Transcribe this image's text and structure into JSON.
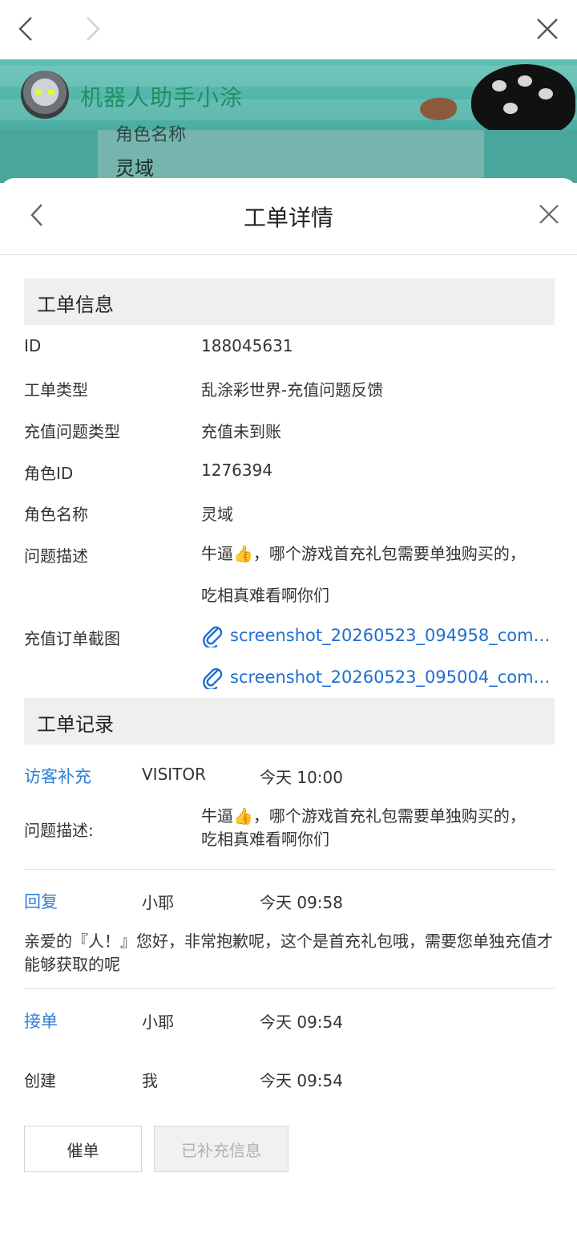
{
  "browser": {
    "back_icon": "chevron-left-icon",
    "forward_icon": "chevron-right-icon",
    "close_icon": "close-icon"
  },
  "banner": {
    "title": "机器人助手小涂",
    "bg_color": "#4aada3",
    "title_color": "#1f8f64"
  },
  "background_page": {
    "label": "角色名称",
    "value": "灵域"
  },
  "sheet": {
    "title": "工单详情"
  },
  "ticket_info": {
    "heading": "工单信息",
    "rows": [
      {
        "label": "ID",
        "value": "188045631"
      },
      {
        "label": "工单类型",
        "value": "乱涂彩世界-充值问题反馈"
      },
      {
        "label": "充值问题类型",
        "value": "充值未到账"
      },
      {
        "label": "角色ID",
        "value": "1276394"
      },
      {
        "label": "角色名称",
        "value": "灵域"
      },
      {
        "label": "问题描述",
        "value": "牛逼👍，哪个游戏首充礼包需要单独购买的，吃相真难看啊你们"
      }
    ],
    "screenshot_label": "充值订单截图",
    "attachments": [
      "screenshot_20260523_094958_com.b...",
      "screenshot_20260523_095004_com.b..."
    ]
  },
  "ticket_records": {
    "heading": "工单记录",
    "visitor_supplement": {
      "action": "访客补充",
      "who": "VISITOR",
      "time": "今天 10:00",
      "desc_label": "问题描述:",
      "desc_value": "牛逼👍，哪个游戏首充礼包需要单独购买的，吃相真难看啊你们"
    },
    "reply": {
      "action": "回复",
      "who": "小耶",
      "time": "今天 09:58",
      "message": "亲爱的『人！』您好，非常抱歉呢，这个是首充礼包哦，需要您单独充值才能够获取的呢"
    },
    "accept": {
      "action": "接单",
      "who": "小耶",
      "time": "今天 09:54"
    },
    "create": {
      "action": "创建",
      "who": "我",
      "time": "今天 09:54"
    }
  },
  "actions": {
    "urge": "催单",
    "supplemented": "已补充信息"
  },
  "colors": {
    "link": "#1f6fd1",
    "record_action": "#2f7fd3",
    "section_bg": "#efefef"
  }
}
